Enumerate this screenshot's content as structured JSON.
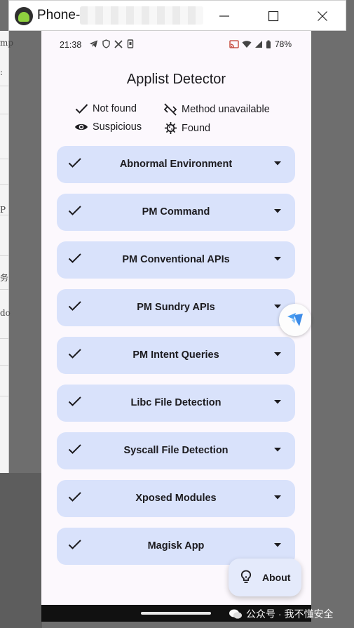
{
  "window": {
    "title": "Phone-",
    "controls": {
      "minimize_icon": "minimize-icon",
      "maximize_icon": "maximize-icon",
      "close_icon": "close-icon"
    }
  },
  "status_bar": {
    "time": "21:38",
    "battery": "78%"
  },
  "app": {
    "title": "Applist Detector",
    "legend": [
      {
        "icon": "check-icon",
        "label": "Not found"
      },
      {
        "icon": "code-off-icon",
        "label": "Method unavailable"
      },
      {
        "icon": "eye-icon",
        "label": "Suspicious"
      },
      {
        "icon": "virus-icon",
        "label": "Found"
      }
    ],
    "detections": [
      {
        "label": "Abnormal Environment",
        "status": "Not found"
      },
      {
        "label": "PM Command",
        "status": "Not found"
      },
      {
        "label": "PM Conventional APIs",
        "status": "Not found"
      },
      {
        "label": "PM Sundry APIs",
        "status": "Not found"
      },
      {
        "label": "PM Intent Queries",
        "status": "Not found"
      },
      {
        "label": "Libc File Detection",
        "status": "Not found"
      },
      {
        "label": "Syscall File Detection",
        "status": "Not found"
      },
      {
        "label": "Xposed Modules",
        "status": "Not found"
      },
      {
        "label": "Magisk App",
        "status": "Not found"
      }
    ],
    "about_button": "About"
  },
  "overlay": {
    "watermark": "公众号 · 我不懂安全"
  },
  "background_window_chars": [
    "mp",
    ":",
    "P",
    "务",
    "do"
  ],
  "colors": {
    "card_bg": "#d9e2fb",
    "screen_bg": "#fcf8fd",
    "text": "#1c1b1f"
  }
}
